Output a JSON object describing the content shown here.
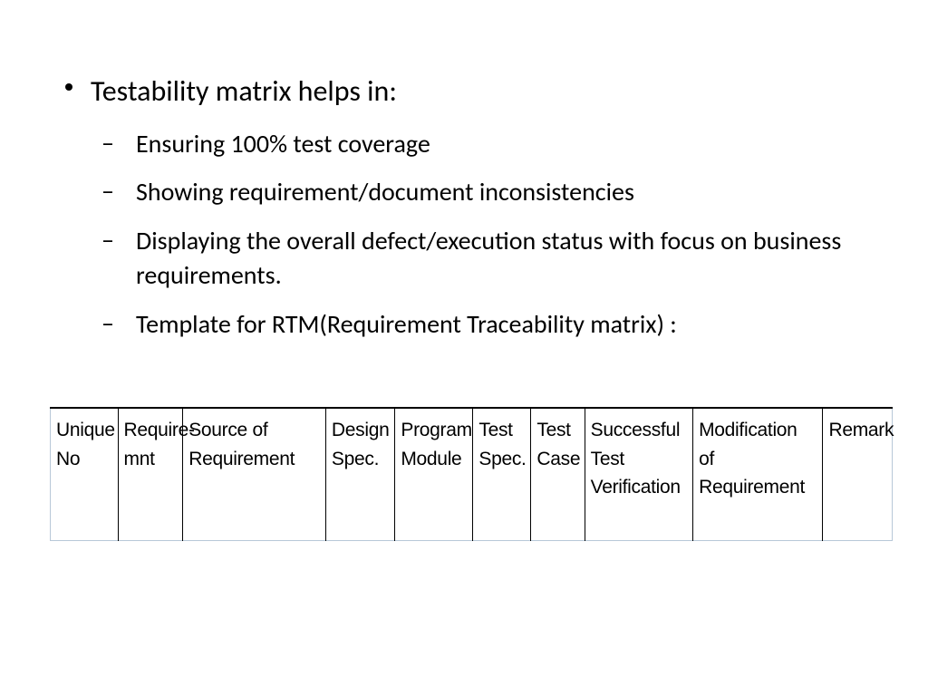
{
  "slide": {
    "main_bullet": "Testability matrix helps in:",
    "sub_bullets": [
      "Ensuring 100% test coverage",
      "Showing requirement/document inconsistencies",
      "Displaying the overall defect/execution status with focus on business requirements.",
      "Template for RTM(Requirement Traceability matrix) :"
    ]
  },
  "table": {
    "headers": [
      "Unique No",
      "Require-mnt",
      "Source of Requirement",
      "Design Spec.",
      "Program Module",
      "Test Spec.",
      "Test Case",
      "Successful Test Verification",
      "Modification of Requirement",
      "Remark"
    ]
  }
}
